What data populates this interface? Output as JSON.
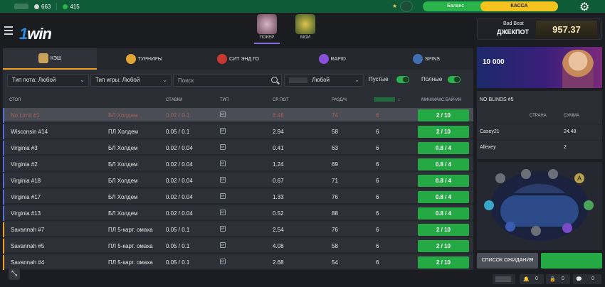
{
  "topbar": {
    "stat1": "663",
    "stat2": "415",
    "balance_label": "Баланс",
    "kassa_label": "КАССА",
    "colors": {
      "bg": "#0f5a37",
      "balance": "#2ab34a",
      "kassa": "#f5c320"
    }
  },
  "header": {
    "logo": "1win",
    "tabs": [
      {
        "label": "ПОКЕР"
      },
      {
        "label": "МОИ"
      }
    ]
  },
  "jackpot": {
    "line1": "Bad Beat",
    "line2": "ДЖЕКПОТ",
    "amount": "957.37"
  },
  "game_tabs": [
    {
      "label": "КЭШ",
      "icon": "cash-icon"
    },
    {
      "label": "ТУРНИРЫ",
      "icon": "trophy-icon"
    },
    {
      "label": "СИТ ЭНД ГО",
      "icon": "sit-and-go-icon"
    },
    {
      "label": "RAPID",
      "icon": "timer-icon"
    },
    {
      "label": "SPINS",
      "icon": "spins-icon"
    }
  ],
  "filters": {
    "pot_type": "Тип пота: Любой",
    "game_type": "Тип игры: Любой",
    "search_placeholder": "Поиск",
    "any_select": "Любой",
    "empty_label": "Пустые",
    "full_label": "Полные"
  },
  "table_headers": {
    "table": "СТОЛ",
    "stakes": "СТАВКИ",
    "type": "ТИП",
    "avg_pot": "СР ПОТ",
    "hands_per_hour": "РАЗД/Ч",
    "buyin": "МИН/МАКС БАЙ-ИН"
  },
  "rows": [
    {
      "name": "No Limit #1",
      "game": "БЛ Холдем",
      "stakes": "0.02 / 0.1",
      "pot": "8.48",
      "hands": "74",
      "players": "6",
      "buyin": "2 / 10",
      "highlight": true
    },
    {
      "name": "Wisconsin #14",
      "game": "ПЛ Холдем",
      "stakes": "0.05 / 0.1",
      "pot": "2.94",
      "hands": "58",
      "players": "6",
      "buyin": "2 / 10",
      "highlight": false
    },
    {
      "name": "Virginia #3",
      "game": "БЛ Холдем",
      "stakes": "0.02 / 0.04",
      "pot": "0.41",
      "hands": "63",
      "players": "6",
      "buyin": "0.8 / 4",
      "highlight": false
    },
    {
      "name": "Virginia #2",
      "game": "БЛ Холдем",
      "stakes": "0.02 / 0.04",
      "pot": "1.24",
      "hands": "69",
      "players": "6",
      "buyin": "0.8 / 4",
      "highlight": false
    },
    {
      "name": "Virginia #18",
      "game": "БЛ Холдем",
      "stakes": "0.02 / 0.04",
      "pot": "0.67",
      "hands": "71",
      "players": "6",
      "buyin": "0.8 / 4",
      "highlight": false
    },
    {
      "name": "Virginia #17",
      "game": "БЛ Холдем",
      "stakes": "0.02 / 0.04",
      "pot": "1.33",
      "hands": "76",
      "players": "6",
      "buyin": "0.8 / 4",
      "highlight": false
    },
    {
      "name": "Virginia #13",
      "game": "БЛ Холдем",
      "stakes": "0.02 / 0.04",
      "pot": "0.52",
      "hands": "88",
      "players": "6",
      "buyin": "0.8 / 4",
      "highlight": false
    },
    {
      "name": "Savannah #7",
      "game": "ПЛ 5-карт. омаха",
      "stakes": "0.05 / 0.1",
      "pot": "2.54",
      "hands": "76",
      "players": "6",
      "buyin": "2 / 10",
      "highlight": false
    },
    {
      "name": "Savannah #5",
      "game": "ПЛ 5-карт. омаха",
      "stakes": "0.05 / 0.1",
      "pot": "4.08",
      "hands": "58",
      "players": "6",
      "buyin": "2 / 10",
      "highlight": false
    },
    {
      "name": "Savannah #4",
      "game": "ПЛ 5-карт. омаха",
      "stakes": "0.05 / 0.1",
      "pot": "2.68",
      "hands": "54",
      "players": "6",
      "buyin": "2 / 10",
      "highlight": false
    }
  ],
  "promo": {
    "text": "10 000"
  },
  "side_table": {
    "title": "NO BLINDS #5",
    "col_country": "СТРАНА",
    "col_sum": "СУММА",
    "players": [
      {
        "name": "Casey21",
        "sum": "24.48"
      },
      {
        "name": "Allexey",
        "sum": "2"
      }
    ]
  },
  "seat_badge": "A",
  "waitlist_label": "СПИСОК ОЖИДАНИЯ",
  "bottom": {
    "count1": "0",
    "count2": "0",
    "count3": "0"
  }
}
